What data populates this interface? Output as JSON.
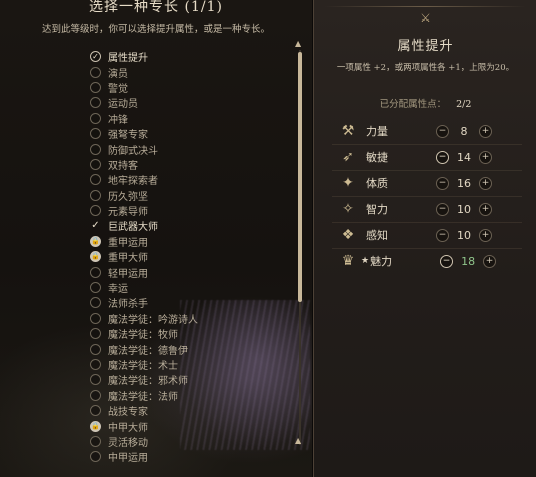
{
  "left_panel": {
    "title": "选择一种专长 (1/1)",
    "subtitle": "达到此等级时，你可以选择提升属性，或是一种专长。",
    "skills": [
      {
        "label": "属性提升",
        "state": "check"
      },
      {
        "label": "演员",
        "state": "none"
      },
      {
        "label": "警觉",
        "state": "none"
      },
      {
        "label": "运动员",
        "state": "none"
      },
      {
        "label": "冲锋",
        "state": "none"
      },
      {
        "label": "强弩专家",
        "state": "none"
      },
      {
        "label": "防御式决斗",
        "state": "none"
      },
      {
        "label": "双持客",
        "state": "none"
      },
      {
        "label": "地牢探索者",
        "state": "none"
      },
      {
        "label": "历久弥坚",
        "state": "none"
      },
      {
        "label": "元素导师",
        "state": "none"
      },
      {
        "label": "巨武器大师",
        "state": "tick"
      },
      {
        "label": "重甲运用",
        "state": "lock"
      },
      {
        "label": "重甲大师",
        "state": "lock"
      },
      {
        "label": "轻甲运用",
        "state": "none"
      },
      {
        "label": "幸运",
        "state": "none"
      },
      {
        "label": "法师杀手",
        "state": "none"
      },
      {
        "label": "魔法学徒：吟游诗人",
        "state": "none"
      },
      {
        "label": "魔法学徒：牧师",
        "state": "none"
      },
      {
        "label": "魔法学徒：德鲁伊",
        "state": "none"
      },
      {
        "label": "魔法学徒：术士",
        "state": "none"
      },
      {
        "label": "魔法学徒：邪术师",
        "state": "none"
      },
      {
        "label": "魔法学徒：法师",
        "state": "none"
      },
      {
        "label": "战技专家",
        "state": "none"
      },
      {
        "label": "中甲大师",
        "state": "lock"
      },
      {
        "label": "灵活移动",
        "state": "none"
      },
      {
        "label": "中甲运用",
        "state": "none"
      }
    ],
    "marker_glyphs": {
      "check": "✓",
      "tick": "✓",
      "lock": "🔒",
      "none": ""
    }
  },
  "right_panel": {
    "emblem_icon": "crossed-axe-emblem",
    "title": "属性提升",
    "description": "一项属性 +2，或两项属性各 +1，上限为20。",
    "points_label": "已分配属性点：",
    "points_value": "2/2",
    "abilities": [
      {
        "name": "力量",
        "value": "8",
        "icon": "str-icon",
        "boosted": false,
        "starred": false
      },
      {
        "name": "敏捷",
        "value": "14",
        "icon": "dex-icon",
        "boosted": false,
        "starred": false
      },
      {
        "name": "体质",
        "value": "16",
        "icon": "con-icon",
        "boosted": false,
        "starred": false
      },
      {
        "name": "智力",
        "value": "10",
        "icon": "int-icon",
        "boosted": false,
        "starred": false
      },
      {
        "name": "感知",
        "value": "10",
        "icon": "wis-icon",
        "boosted": false,
        "starred": false
      },
      {
        "name": "魅力",
        "value": "18",
        "icon": "cha-icon",
        "boosted": true,
        "starred": true
      }
    ],
    "star_glyph": "★",
    "minus_glyph": "−",
    "plus_glyph": "+"
  },
  "colors": {
    "boosted_value": "#8fc48a",
    "accent_gold": "#c8b89a"
  }
}
